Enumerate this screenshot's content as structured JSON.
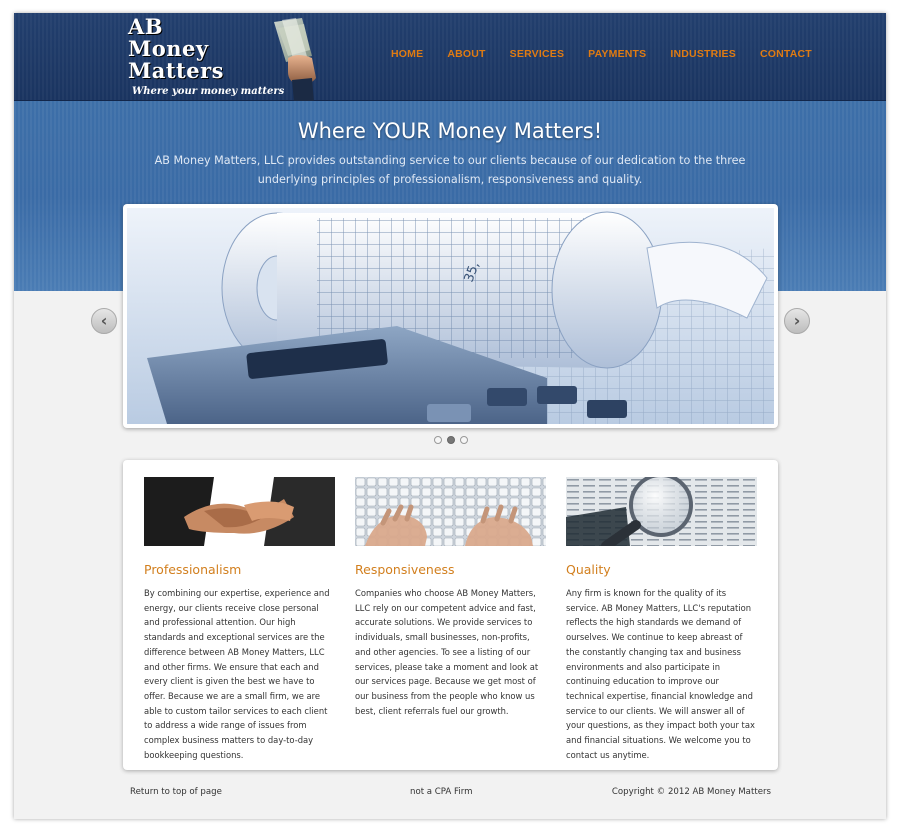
{
  "logo": {
    "line1": "AB",
    "line2": "Money",
    "line3": "Matters",
    "tagline": "Where your money matters"
  },
  "nav": {
    "items": [
      "HOME",
      "ABOUT",
      "SERVICES",
      "PAYMENTS",
      "INDUSTRIES",
      "CONTACT"
    ]
  },
  "hero": {
    "title": "Where YOUR Money Matters!",
    "subtitle": "AB Money Matters, LLC provides outstanding service to our clients because of our dedication to the three underlying principles of professionalism, responsiveness and quality."
  },
  "slider": {
    "prev_icon": "chevron-left-icon",
    "next_icon": "chevron-right-icon",
    "dots": 3,
    "active_dot": 1
  },
  "columns": [
    {
      "heading": "Professionalism",
      "image": "handshake-photo",
      "text": "By combining our expertise, experience and energy, our clients receive close personal and professional attention. Our high standards and exceptional services are the difference between AB Money Matters, LLC and other firms. We ensure that each and every client is given the best we have to offer. Because we are a small firm, we are able to custom tailor services to each client to address a wide range of issues from complex business matters to day-to-day bookkeeping questions."
    },
    {
      "heading": "Responsiveness",
      "image": "keyboard-typing-photo",
      "text": "Companies who choose AB Money Matters, LLC rely on our competent advice and fast, accurate solutions. We provide services to individuals, small businesses, non-profits, and other agencies. To see a listing of our services, please take a moment and look at our services page. Because we get most of our business from the people who know us best, client referrals fuel our growth."
    },
    {
      "heading": "Quality",
      "image": "magnifying-glass-photo",
      "text": "Any firm is known for the quality of its service. AB Money Matters, LLC's reputation reflects the high standards we demand of ourselves. We continue to keep abreast of the constantly changing tax and business environments and also participate in continuing education to improve our technical expertise, financial knowledge and service to our clients. We will answer all of your questions, as they impact both your tax and financial situations. We welcome you to contact us anytime."
    }
  ],
  "footer": {
    "return_link": "Return to top of page",
    "middle": "not a CPA Firm",
    "copyright": "Copyright © 2012 AB Money Matters"
  },
  "colors": {
    "header_bg": "#1f3a68",
    "hero_bg": "#3d6fa8",
    "nav_link": "#e07b12",
    "heading_accent": "#d27f1e",
    "page_bg": "#f2f2f2"
  }
}
